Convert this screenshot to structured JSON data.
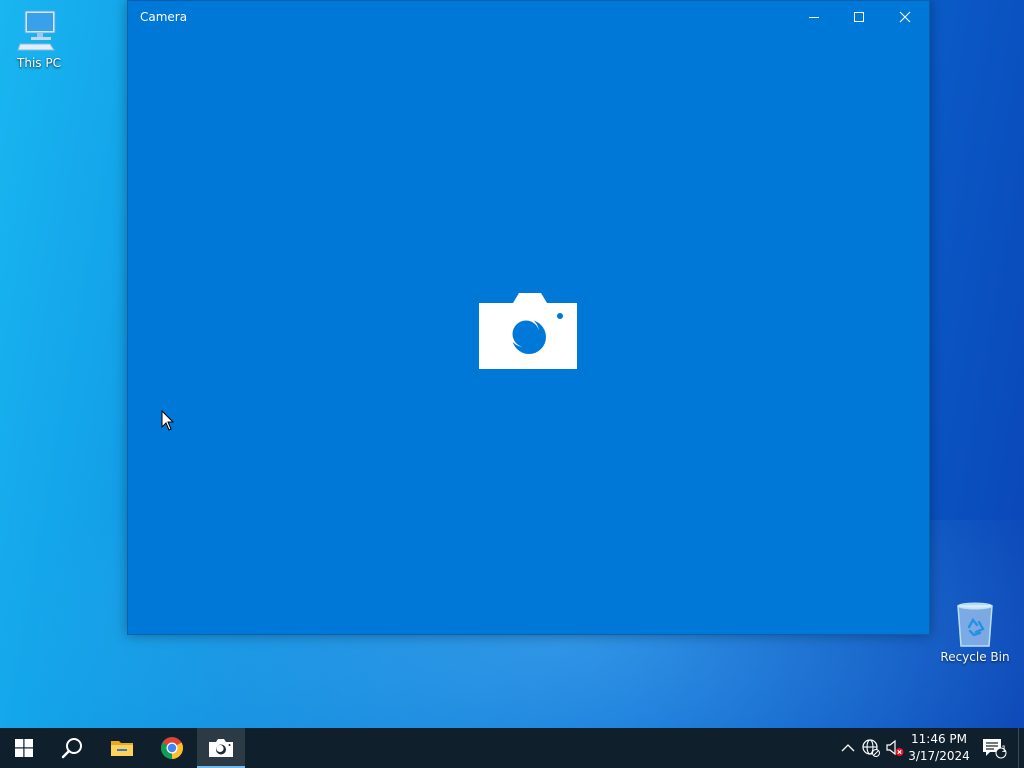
{
  "desktop": {
    "icons": [
      {
        "label": "This PC"
      },
      {
        "label": "Recycle Bin"
      }
    ]
  },
  "window": {
    "title": "Camera",
    "placeholder_icon": "camera-icon",
    "background_color": "#0078d7"
  },
  "taskbar": {
    "pinned": [
      {
        "name": "start",
        "icon": "windows-logo-icon"
      },
      {
        "name": "search",
        "icon": "search-icon"
      },
      {
        "name": "file-explorer",
        "icon": "folder-icon"
      },
      {
        "name": "chrome",
        "icon": "chrome-icon"
      },
      {
        "name": "camera",
        "icon": "camera-icon",
        "active": true
      }
    ],
    "tray": {
      "icons": [
        "chevron-up-icon",
        "network-icon",
        "volume-muted-icon"
      ],
      "time": "11:46 PM",
      "date": "3/17/2024",
      "notification_count": "1"
    },
    "background_color": "#0f1f2c",
    "accent_color": "#76b9ed"
  }
}
